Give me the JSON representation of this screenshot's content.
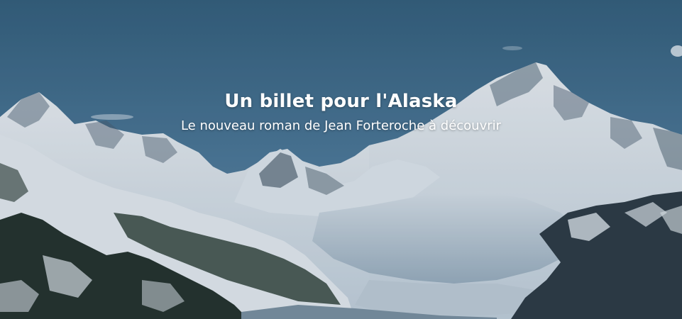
{
  "hero": {
    "title": "Un billet pour l'Alaska",
    "subtitle": "Le nouveau roman de Jean Forteroche à découvrir",
    "background_image": "snowy-alaska-mountains-glacier"
  },
  "colors": {
    "sky_top": "#3b6688",
    "sky_bottom": "#5d88aa",
    "snow": "#eef3f8",
    "rock": "#3a4a58",
    "forest": "#2c3a33",
    "text": "#ffffff"
  }
}
